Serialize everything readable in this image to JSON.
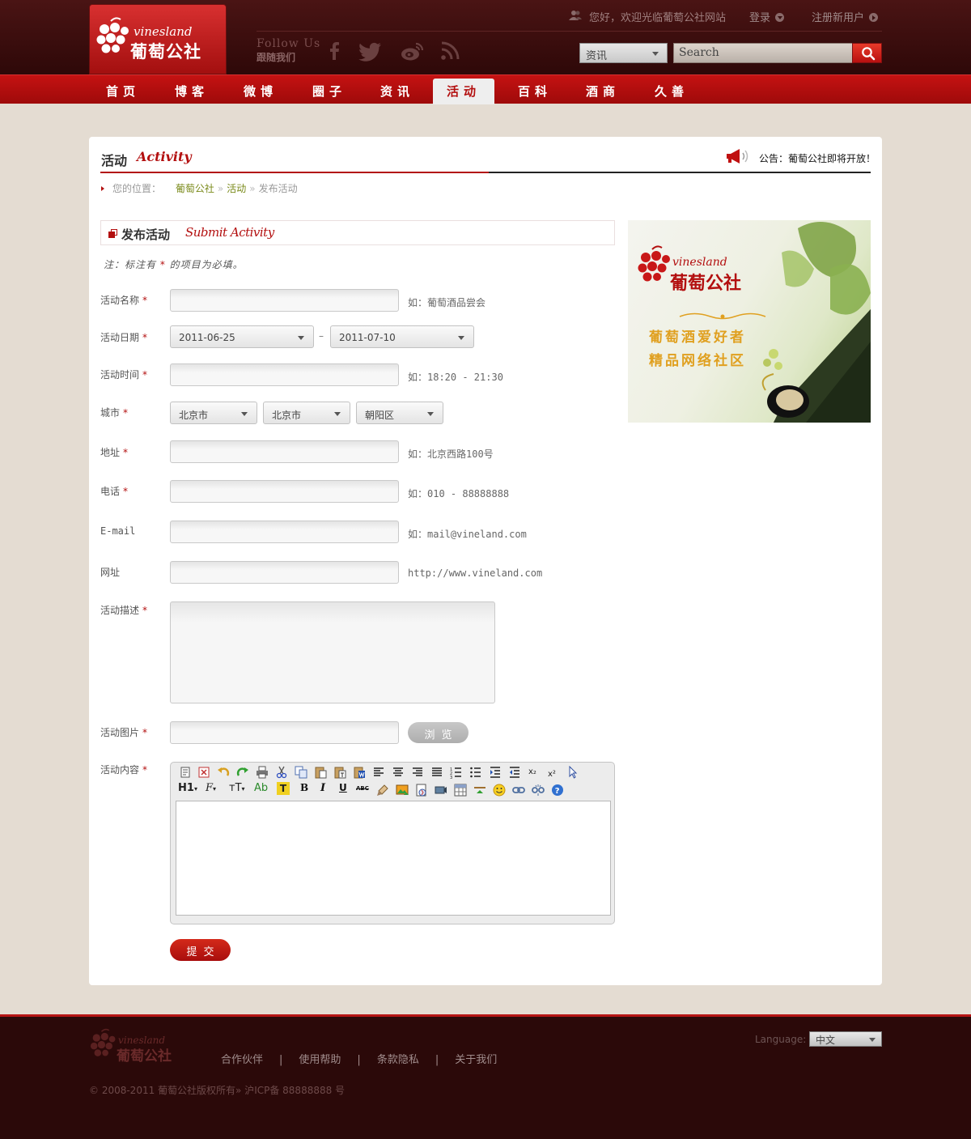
{
  "header": {
    "logo_en": "vinesland",
    "logo_cn": "葡萄公社",
    "follow_en": "Follow Us",
    "follow_cn": "跟随我们",
    "social_icons": [
      "facebook-icon",
      "twitter-icon",
      "weibo-icon",
      "rss-icon"
    ],
    "welcome": "您好，欢迎光临葡萄公社网站",
    "login": "登录",
    "register": "注册新用户",
    "category_select": "资讯",
    "search_placeholder": "Search"
  },
  "nav": {
    "items": [
      {
        "label": "首页"
      },
      {
        "label": "博客"
      },
      {
        "label": "微博"
      },
      {
        "label": "圈子"
      },
      {
        "label": "资讯"
      },
      {
        "label": "活动"
      },
      {
        "label": "百科"
      },
      {
        "label": "酒商"
      },
      {
        "label": "久善"
      }
    ],
    "active_index": 5
  },
  "section": {
    "title_cn": "活动",
    "title_en": "Activity",
    "notice": "公告：葡萄公社即将开放！"
  },
  "breadcrumb": {
    "label": "您的位置：",
    "items": [
      "葡萄公社",
      "活动",
      "发布活动"
    ]
  },
  "form": {
    "title_cn": "发布活动",
    "title_en": "Submit Activity",
    "note_prefix": "注：标注有",
    "note_star": "*",
    "note_suffix": "的项目为必填。",
    "required_mark": "*",
    "name_label": "活动名称",
    "name_hint": "如：葡萄酒品尝会",
    "date_label": "活动日期",
    "date_start": "2011-06-25",
    "date_sep": "–",
    "date_end": "2011-07-10",
    "time_label": "活动时间",
    "time_hint": "如：18:20 - 21:30",
    "city_label": "城市",
    "province": "北京市",
    "city": "北京市",
    "district": "朝阳区",
    "address_label": "地址",
    "address_hint": "如：北京西路100号",
    "phone_label": "电话",
    "phone_hint": "如：010 - 88888888",
    "email_label": "E-mail",
    "email_hint": "如：mail@vineland.com",
    "url_label": "网址",
    "url_hint": "http://www.vineland.com",
    "desc_label": "活动描述",
    "image_label": "活动图片",
    "browse": "浏览",
    "content_label": "活动内容",
    "submit": "提交"
  },
  "editor": {
    "tools_row1": [
      "source-icon",
      "fullscreen-icon",
      "undo-icon",
      "redo-icon",
      "print-icon",
      "cut-icon",
      "copy-icon",
      "paste-icon",
      "paste-text-icon",
      "paste-word-icon",
      "align-left-icon",
      "align-center-icon",
      "align-right-icon",
      "align-justify-icon",
      "ordered-list-icon",
      "unordered-list-icon",
      "indent-icon",
      "outdent-icon",
      "subscript-icon",
      "superscript-icon",
      "select-icon"
    ],
    "tools_row2": [
      "heading-icon",
      "font-family-icon",
      "font-size-icon",
      "text-color-icon",
      "highlight-icon",
      "bold-icon",
      "italic-icon",
      "underline-icon",
      "strikethrough-icon",
      "clear-format-icon",
      "image-icon",
      "flash-icon",
      "media-icon",
      "table-icon",
      "hr-icon",
      "emoticon-icon",
      "link-icon",
      "unlink-icon",
      "help-icon"
    ],
    "labels": {
      "heading": "H1",
      "font_family": "F",
      "font_size": "тT",
      "text_color": "Ab",
      "highlight": "T",
      "bold": "B",
      "italic": "I",
      "underline": "U",
      "strike": "ABC",
      "sub": "x₂",
      "sup": "x²"
    }
  },
  "banner": {
    "logo_en": "vinesland",
    "logo_cn": "葡萄公社",
    "slogan1": "葡萄酒爱好者",
    "slogan2": "精品网络社区"
  },
  "footer": {
    "logo_en": "vinesland",
    "logo_cn": "葡萄公社",
    "links": [
      "合作伙伴",
      "使用帮助",
      "条款隐私",
      "关于我们"
    ],
    "separator": "|",
    "copyright": "© 2008-2011 葡萄公社版权所有»   沪ICP备 88888888 号",
    "language_label": "Language:",
    "language": "中文"
  },
  "colors": {
    "brand_red": "#b30f0f",
    "header_dark": "#2e0808",
    "page_bg": "#e4dcd2"
  }
}
